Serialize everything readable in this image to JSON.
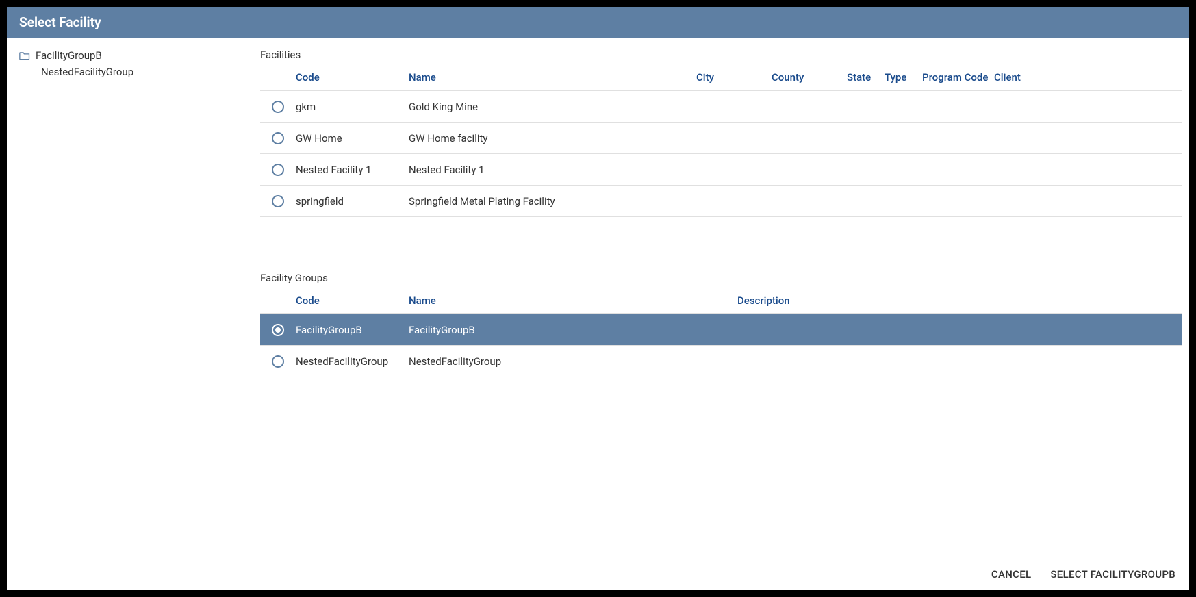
{
  "dialog": {
    "title": "Select Facility"
  },
  "sidebar": {
    "items": [
      {
        "label": "FacilityGroupB",
        "icon": "folder-icon",
        "depth": 0
      },
      {
        "label": "NestedFacilityGroup",
        "icon": null,
        "depth": 1
      }
    ]
  },
  "facilities": {
    "title": "Facilities",
    "columns": {
      "code": "Code",
      "name": "Name",
      "city": "City",
      "county": "County",
      "state": "State",
      "type": "Type",
      "program_code": "Program Code",
      "client": "Client"
    },
    "rows": [
      {
        "code": "gkm",
        "name": "Gold King Mine",
        "city": "",
        "county": "",
        "state": "",
        "type": "",
        "program_code": "",
        "client": "",
        "selected": false
      },
      {
        "code": "GW Home",
        "name": "GW Home facility",
        "city": "",
        "county": "",
        "state": "",
        "type": "",
        "program_code": "",
        "client": "",
        "selected": false
      },
      {
        "code": "Nested Facility 1",
        "name": "Nested Facility 1",
        "city": "",
        "county": "",
        "state": "",
        "type": "",
        "program_code": "",
        "client": "",
        "selected": false
      },
      {
        "code": "springfield",
        "name": "Springfield Metal Plating Facility",
        "city": "",
        "county": "",
        "state": "",
        "type": "",
        "program_code": "",
        "client": "",
        "selected": false
      }
    ]
  },
  "facility_groups": {
    "title": "Facility Groups",
    "columns": {
      "code": "Code",
      "name": "Name",
      "description": "Description"
    },
    "rows": [
      {
        "code": "FacilityGroupB",
        "name": "FacilityGroupB",
        "description": "",
        "selected": true
      },
      {
        "code": "NestedFacilityGroup",
        "name": "NestedFacilityGroup",
        "description": "",
        "selected": false
      }
    ]
  },
  "footer": {
    "cancel": "CANCEL",
    "select": "SELECT FACILITYGROUPB"
  }
}
